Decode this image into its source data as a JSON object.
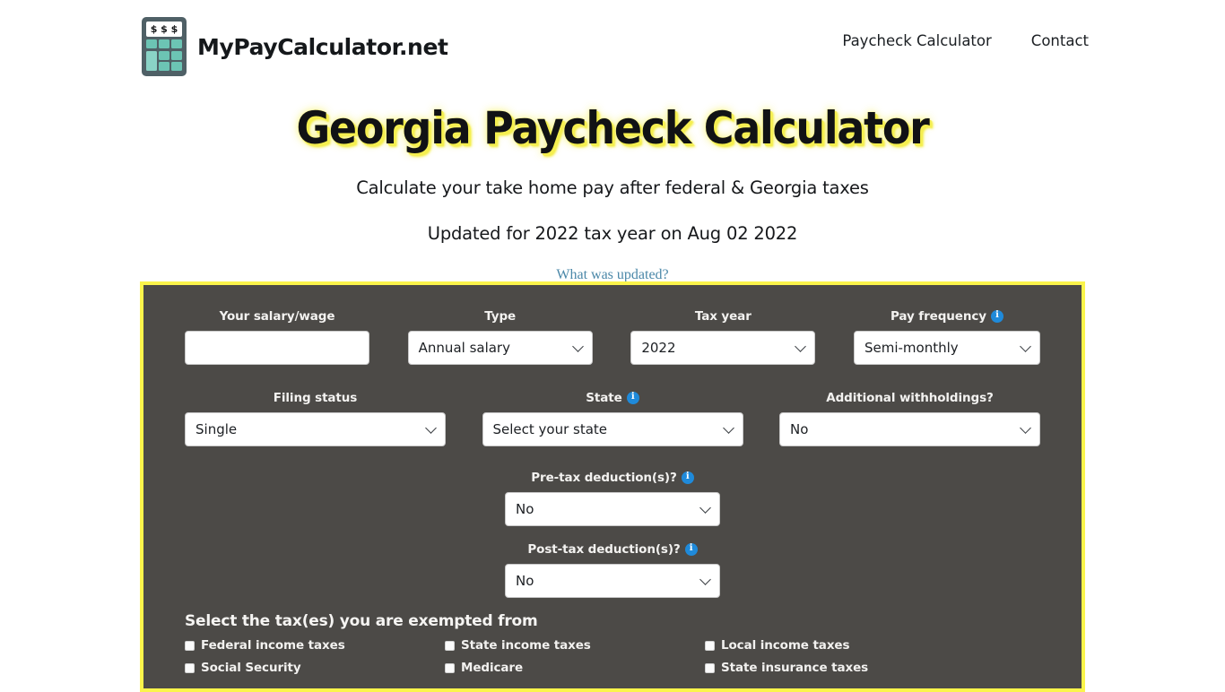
{
  "header": {
    "brand_name": "MyPayCalculator.net",
    "logo_screen_text": "$ $ $",
    "nav": [
      {
        "label": "Paycheck Calculator"
      },
      {
        "label": "Contact"
      }
    ]
  },
  "hero": {
    "title": "Georgia Paycheck Calculator",
    "subtitle": "Calculate your take home pay after federal & Georgia taxes",
    "updated_line": "Updated for 2022 tax year on Aug 02 2022",
    "updated_link": "What was updated?",
    "title_glow_color": "#f5ef50",
    "link_color": "#4a87a8"
  },
  "calculator": {
    "panel_border_color": "#fbf44b",
    "panel_bg_color": "#4c4a47",
    "info_icon_color": "#1f8ada",
    "row1": [
      {
        "label": "Your salary/wage",
        "info": false,
        "type": "text",
        "value": "",
        "placeholder": ""
      },
      {
        "label": "Type",
        "info": false,
        "type": "select",
        "value": "Annual salary"
      },
      {
        "label": "Tax year",
        "info": false,
        "type": "select",
        "value": "2022"
      },
      {
        "label": "Pay frequency",
        "info": true,
        "type": "select",
        "value": "Semi-monthly"
      }
    ],
    "row2": [
      {
        "label": "Filing status",
        "info": false,
        "type": "select",
        "value": "Single"
      },
      {
        "label": "State",
        "info": true,
        "type": "select",
        "value": "Select your state"
      },
      {
        "label": "Additional withholdings?",
        "info": false,
        "type": "select",
        "value": "No"
      }
    ],
    "row3": [
      {
        "label": "Pre-tax deduction(s)?",
        "info": true,
        "type": "select",
        "value": "No"
      }
    ],
    "row4": [
      {
        "label": "Post-tax deduction(s)?",
        "info": true,
        "type": "select",
        "value": "No"
      }
    ],
    "exempt": {
      "title": "Select the tax(es) you are exempted from",
      "items": [
        {
          "label": "Federal income taxes",
          "checked": false
        },
        {
          "label": "State income taxes",
          "checked": false
        },
        {
          "label": "Local income taxes",
          "checked": false
        },
        {
          "label": "Social Security",
          "checked": false
        },
        {
          "label": "Medicare",
          "checked": false
        },
        {
          "label": "State insurance taxes",
          "checked": false
        }
      ]
    }
  }
}
